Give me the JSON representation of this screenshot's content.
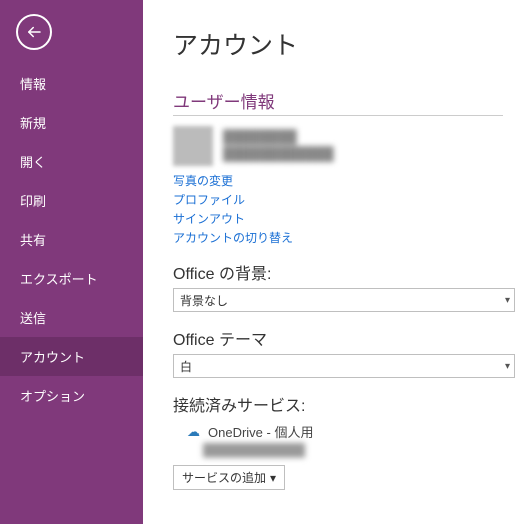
{
  "sidebar": {
    "items": [
      {
        "label": "情報"
      },
      {
        "label": "新規"
      },
      {
        "label": "開く"
      },
      {
        "label": "印刷"
      },
      {
        "label": "共有"
      },
      {
        "label": "エクスポート"
      },
      {
        "label": "送信"
      },
      {
        "label": "アカウント"
      },
      {
        "label": "オプション"
      }
    ],
    "activeIndex": 7
  },
  "main": {
    "title": "アカウント",
    "userInfo": {
      "heading": "ユーザー情報",
      "displayName": "████████",
      "email": "████████████",
      "links": {
        "changePhoto": "写真の変更",
        "profile": "プロファイル",
        "signOut": "サインアウト",
        "switchAccount": "アカウントの切り替え"
      }
    },
    "officeBackground": {
      "heading": "Office の背景:",
      "value": "背景なし"
    },
    "officeTheme": {
      "heading": "Office テーマ",
      "value": "白"
    },
    "connectedServices": {
      "heading": "接続済みサービス:",
      "service": "OneDrive - 個人用",
      "serviceAccount": "████████████",
      "addButton": "サービスの追加"
    }
  },
  "icons": {
    "backArrow": "←",
    "dropdownChevron": "▾",
    "cloud": "☁"
  }
}
